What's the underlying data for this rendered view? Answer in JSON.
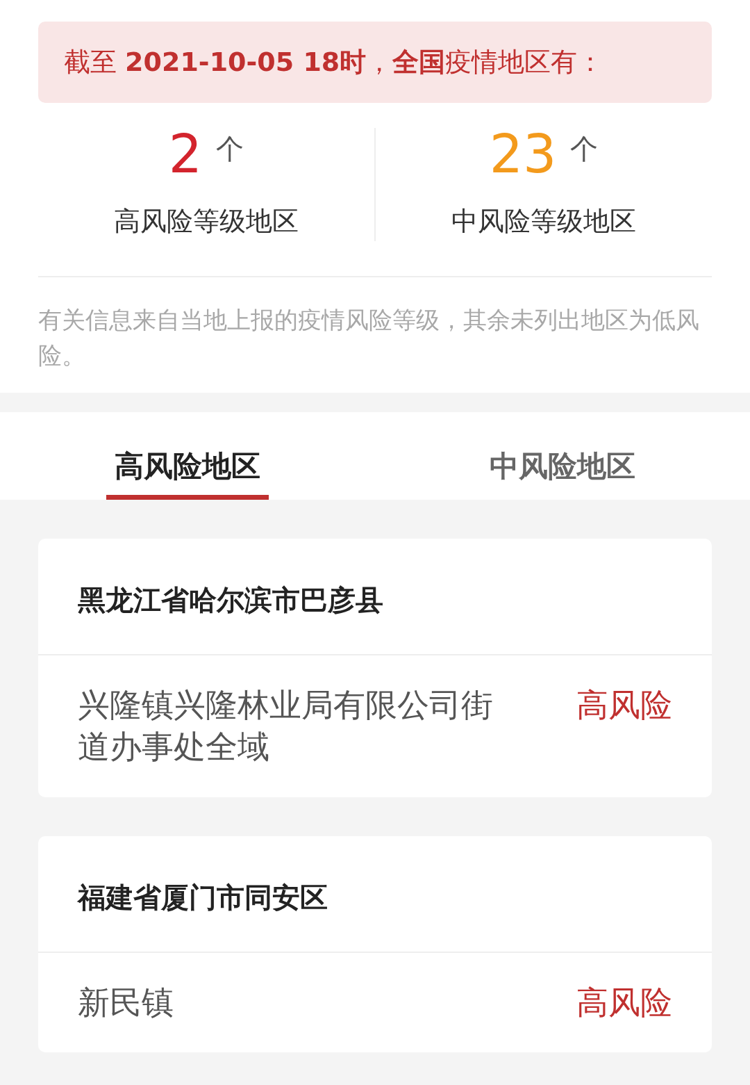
{
  "banner": "截至 **2021-10-05 18时**，**全国**疫情地区有：",
  "stats": [
    {
      "count": "2",
      "unit": "个",
      "label": "高风险等级地区",
      "color": "#d3242d"
    },
    {
      "count": "23",
      "unit": "个",
      "label": "中风险等级地区",
      "color": "#f39a1c"
    }
  ],
  "note": "有关信息来自当地上报的疫情风险等级，其余未列出地区为低风险。",
  "tabs": [
    {
      "label": "高风险地区",
      "selected": true
    },
    {
      "label": "中风险地区",
      "selected": false
    }
  ],
  "regions": [
    {
      "name": "黑龙江省哈尔滨市巴彦县",
      "areas": [
        {
          "name": "兴隆镇兴隆林业局有限公司街道办事处全域",
          "risk": "高风险",
          "kind": "high"
        }
      ]
    },
    {
      "name": "福建省厦门市同安区",
      "areas": [
        {
          "name": "新民镇",
          "risk": "高风险",
          "kind": "high"
        }
      ]
    }
  ]
}
